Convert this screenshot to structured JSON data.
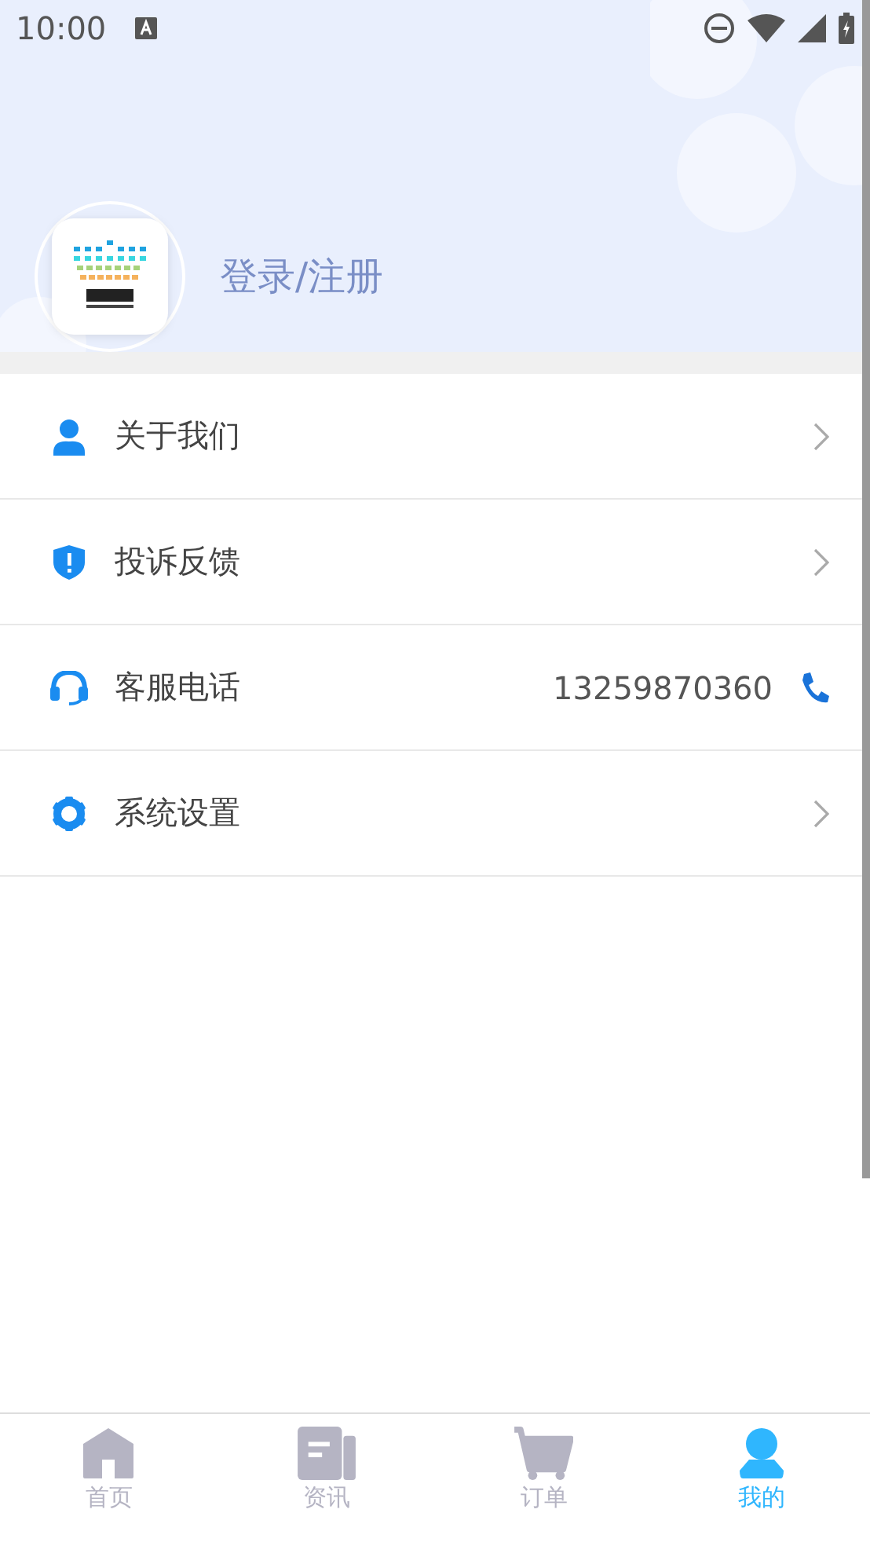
{
  "status_bar": {
    "time": "10:00"
  },
  "profile": {
    "login_label": "登录/注册"
  },
  "menu": [
    {
      "label": "关于我们",
      "kind": "link"
    },
    {
      "label": "投诉反馈",
      "kind": "link"
    },
    {
      "label": "客服电话",
      "kind": "phone",
      "value": "13259870360"
    },
    {
      "label": "系统设置",
      "kind": "link"
    }
  ],
  "tabs": [
    {
      "label": "首页",
      "selected": false
    },
    {
      "label": "资讯",
      "selected": false
    },
    {
      "label": "订单",
      "selected": false
    },
    {
      "label": "我的",
      "selected": true
    }
  ]
}
